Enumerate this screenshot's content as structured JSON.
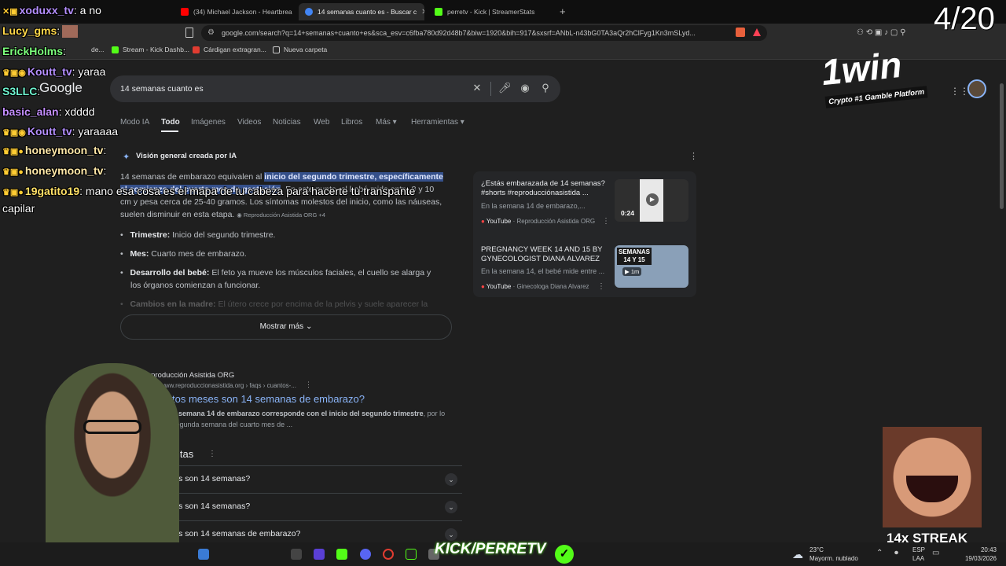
{
  "tabs": [
    {
      "label": "(34) Michael Jackson - Heartbreak Ho",
      "color": "#ff0000"
    },
    {
      "label": "14 semanas cuanto es - Buscar c",
      "color": "#4285f4"
    },
    {
      "label": "perretv - Kick | StreamerStats",
      "color": "#53fc18"
    }
  ],
  "new_tab_label": "+",
  "url": "google.com/search?q=14+semanas+cuanto+es&sca_esv=c6fba780d92d48b7&biw=1920&bih=917&sxsrf=ANbL-n43bG0TA3aQr2hClFyg1Kn3mSLyd...",
  "bookmarks": [
    "Stream - Kick Dashb...",
    "Cárdigan extragran...",
    "Nueva carpeta"
  ],
  "bookmark_prefix": "de...",
  "google": {
    "logo": "Google",
    "query": "14 semanas cuanto es",
    "tabs": [
      "Modo IA",
      "Todo",
      "Imágenes",
      "Videos",
      "Noticias",
      "Web",
      "Libros",
      "Más",
      "Herramientas"
    ],
    "ai_header": "Visión general creada por IA",
    "ai_text_1": "14 semanas de embarazo equivalen al",
    "ai_highlight_1": "inicio del segundo trimestre, específicamente",
    "ai_highlight_2": "al comienzo del cuarto mes de gestación",
    "ai_text_2": ". En este punto, el bebé mide entre 8 y 10",
    "ai_text_3": "cm y pesa cerca de 25-40 gramos. Los síntomas molestos del inicio, como las náuseas,",
    "ai_text_4": "suelen disminuir en esta etapa.",
    "ai_source": "Reproducción Asistida ORG +4",
    "bullets": [
      {
        "label": "Trimestre:",
        "text": "Inicio del segundo trimestre."
      },
      {
        "label": "Mes:",
        "text": "Cuarto mes de embarazo."
      },
      {
        "label": "Desarrollo del bebé:",
        "text": "El feto ya mueve los músculos faciales, el cuello se alarga y"
      },
      {
        "label": "",
        "text": "los órganos comienzan a funcionar."
      },
      {
        "label": "Cambios en la madre:",
        "text": "El útero crece por encima de la pelvis y suele aparecer la"
      }
    ],
    "show_more": "Mostrar más",
    "videos": [
      {
        "title": "¿Estás embarazada de 14 semanas? #shorts #reproducciónasistida ...",
        "snippet": "En la semana 14 de embarazo,...",
        "source": "YouTube",
        "channel": "Reproducción Asistida ORG",
        "duration": "0:24"
      },
      {
        "title": "PREGNANCY WEEK 14 AND 15 BY GYNECOLOGIST DIANA ALVAREZ",
        "snippet": "En la semana 14, el bebé mide entre ...",
        "source": "YouTube",
        "channel": "Ginecologa Diana Alvarez",
        "duration": "1m",
        "thumb_text": "SEMANAS 14 Y 15"
      }
    ],
    "result": {
      "site": "Reproducción Asistida ORG",
      "url": "https://www.reproduccionasistida.org › faqs › cuantos-...",
      "title": "¿Cuántos meses son 14 semanas de embarazo?",
      "date": "2025",
      "snippet_bold": "La semana 14 de embarazo corresponde con el inicio del segundo trimestre",
      "snippet_1": ", por lo",
      "snippet_2": "que es la segunda semana del cuarto mes de ..."
    },
    "paa_header": "Otras preguntas",
    "faqs": [
      "¿Cuántos meses son 14 semanas?",
      "¿Cuántos meses son 14 semanas?",
      "¿Cuántos meses son 14 semanas de embarazo?"
    ]
  },
  "chat": [
    {
      "user": "xoduxx_tv",
      "msg": ": a no"
    },
    {
      "user": "Lucy_gms",
      "msg": ":"
    },
    {
      "user": "ErickHolms",
      "msg": ":"
    },
    {
      "user": "Koutt_tv",
      "msg": ": yaraa"
    },
    {
      "user": "S3LLC",
      "msg": ":"
    },
    {
      "user": "basic_alan",
      "msg": ": xdddd"
    },
    {
      "user": "Koutt_tv",
      "msg": ": yaraaaa"
    },
    {
      "user": "honeymoon_tv",
      "msg": ":"
    },
    {
      "user": "honeymoon_tv",
      "msg": ":"
    },
    {
      "user": "19gatito19",
      "msg": ": mano esa cosa es el mapa de tu cabeza para hacerte tu transpante"
    },
    {
      "user": "",
      "msg": "capilar"
    }
  ],
  "overlay": {
    "counter": "4/20",
    "brand": "1win",
    "brand_sub": "Crypto #1 Gamble Platform",
    "streak": "14x STREAK",
    "kick_text": "KICK/PERRETV"
  },
  "taskbar": {
    "temp": "23°C",
    "weather": "Mayorm. nublado",
    "lang_1": "ESP",
    "lang_2": "LAA",
    "time": "20:43",
    "date": "19/03/2026"
  },
  "colors": {
    "accent": "#8ab4f8",
    "highlight": "#35508a",
    "kick": "#53fc18",
    "chat_user": "#b58fff"
  }
}
